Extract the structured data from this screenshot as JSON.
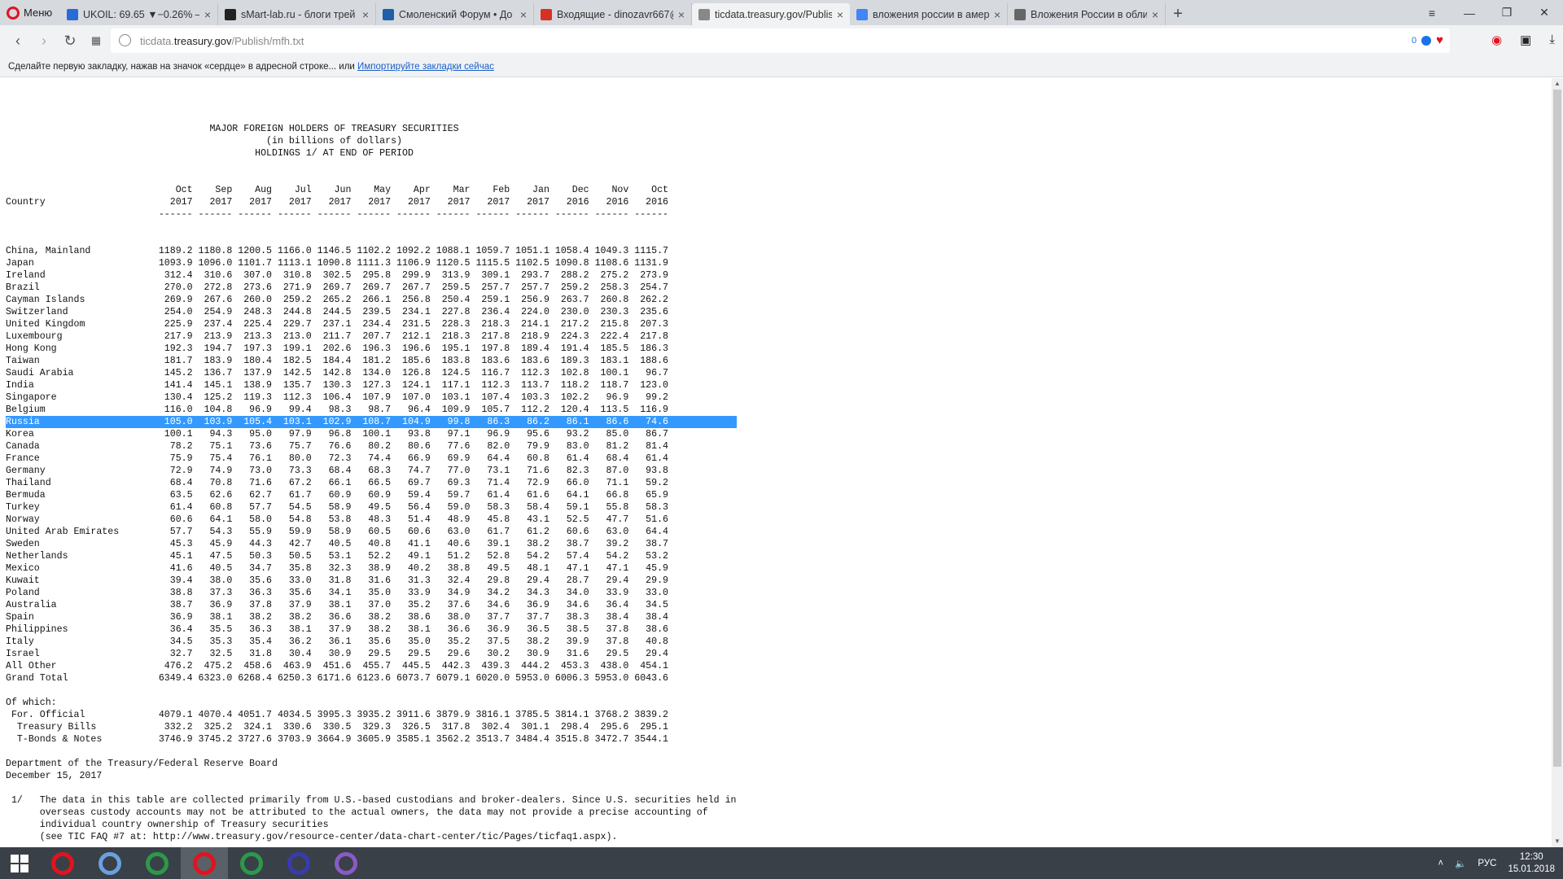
{
  "browser": {
    "menu_label": "Меню",
    "tabs": [
      {
        "title": "UKOIL: 69.65 ▼−0.26% —",
        "favicon": "chart-icon",
        "color": "#2a6ad8"
      },
      {
        "title": "sMart-lab.ru - блоги трей",
        "favicon": "smartlab-icon",
        "color": "#222222"
      },
      {
        "title": "Смоленский Форум • Дo",
        "favicon": "forum-icon",
        "color": "#1f5fa8"
      },
      {
        "title": "Входящие - dinozavr667@",
        "favicon": "gmail-icon",
        "color": "#d93025"
      },
      {
        "title": "ticdata.treasury.gov/Publis",
        "favicon": "page-icon",
        "color": "#888888"
      },
      {
        "title": "вложения россии в амер",
        "favicon": "google-icon",
        "color": "#4285f4"
      },
      {
        "title": "Вложения России в обли",
        "favicon": "loading-icon",
        "color": "#666666"
      }
    ],
    "url_prefix": "ticdata.",
    "url_domain": "treasury.gov",
    "url_path": "/Publish/mfh.txt",
    "badge_count": "0",
    "bookmark_hint": "Сделайте первую закладку, нажав на значок «сердце» в адресной строке... или",
    "bookmark_link": "Импортируйте закладки сейчас"
  },
  "report": {
    "title": "MAJOR FOREIGN HOLDERS OF TREASURY SECURITIES",
    "subtitle": "(in billions of dollars)",
    "subtitle2": "HOLDINGS 1/ AT END OF PERIOD",
    "country_header": "Country",
    "months": [
      "Oct",
      "Sep",
      "Aug",
      "Jul",
      "Jun",
      "May",
      "Apr",
      "Mar",
      "Feb",
      "Jan",
      "Dec",
      "Nov",
      "Oct"
    ],
    "years": [
      "2017",
      "2017",
      "2017",
      "2017",
      "2017",
      "2017",
      "2017",
      "2017",
      "2017",
      "2017",
      "2016",
      "2016",
      "2016"
    ],
    "rows": [
      {
        "country": "China, Mainland",
        "values": [
          "1189.2",
          "1180.8",
          "1200.5",
          "1166.0",
          "1146.5",
          "1102.2",
          "1092.2",
          "1088.1",
          "1059.7",
          "1051.1",
          "1058.4",
          "1049.3",
          "1115.7"
        ]
      },
      {
        "country": "Japan",
        "values": [
          "1093.9",
          "1096.0",
          "1101.7",
          "1113.1",
          "1090.8",
          "1111.3",
          "1106.9",
          "1120.5",
          "1115.5",
          "1102.5",
          "1090.8",
          "1108.6",
          "1131.9"
        ]
      },
      {
        "country": "Ireland",
        "values": [
          "312.4",
          "310.6",
          "307.0",
          "310.8",
          "302.5",
          "295.8",
          "299.9",
          "313.9",
          "309.1",
          "293.7",
          "288.2",
          "275.2",
          "273.9"
        ]
      },
      {
        "country": "Brazil",
        "values": [
          "270.0",
          "272.8",
          "273.6",
          "271.9",
          "269.7",
          "269.7",
          "267.7",
          "259.5",
          "257.7",
          "257.7",
          "259.2",
          "258.3",
          "254.7"
        ]
      },
      {
        "country": "Cayman Islands",
        "values": [
          "269.9",
          "267.6",
          "260.0",
          "259.2",
          "265.2",
          "266.1",
          "256.8",
          "250.4",
          "259.1",
          "256.9",
          "263.7",
          "260.8",
          "262.2"
        ]
      },
      {
        "country": "Switzerland",
        "values": [
          "254.0",
          "254.9",
          "248.3",
          "244.8",
          "244.5",
          "239.5",
          "234.1",
          "227.8",
          "236.4",
          "224.0",
          "230.0",
          "230.3",
          "235.6"
        ]
      },
      {
        "country": "United Kingdom",
        "values": [
          "225.9",
          "237.4",
          "225.4",
          "229.7",
          "237.1",
          "234.4",
          "231.5",
          "228.3",
          "218.3",
          "214.1",
          "217.2",
          "215.8",
          "207.3"
        ]
      },
      {
        "country": "Luxembourg",
        "values": [
          "217.9",
          "213.9",
          "213.3",
          "213.0",
          "211.7",
          "207.7",
          "212.1",
          "218.3",
          "217.8",
          "218.9",
          "224.3",
          "222.4",
          "217.8"
        ]
      },
      {
        "country": "Hong Kong",
        "values": [
          "192.3",
          "194.7",
          "197.3",
          "199.1",
          "202.6",
          "196.3",
          "196.6",
          "195.1",
          "197.8",
          "189.4",
          "191.4",
          "185.5",
          "186.3"
        ]
      },
      {
        "country": "Taiwan",
        "values": [
          "181.7",
          "183.9",
          "180.4",
          "182.5",
          "184.4",
          "181.2",
          "185.6",
          "183.8",
          "183.6",
          "183.6",
          "189.3",
          "183.1",
          "188.6"
        ]
      },
      {
        "country": "Saudi Arabia",
        "values": [
          "145.2",
          "136.7",
          "137.9",
          "142.5",
          "142.8",
          "134.0",
          "126.8",
          "124.5",
          "116.7",
          "112.3",
          "102.8",
          "100.1",
          "96.7"
        ]
      },
      {
        "country": "India",
        "values": [
          "141.4",
          "145.1",
          "138.9",
          "135.7",
          "130.3",
          "127.3",
          "124.1",
          "117.1",
          "112.3",
          "113.7",
          "118.2",
          "118.7",
          "123.0"
        ]
      },
      {
        "country": "Singapore",
        "values": [
          "130.4",
          "125.2",
          "119.3",
          "112.3",
          "106.4",
          "107.9",
          "107.0",
          "103.1",
          "107.4",
          "103.3",
          "102.2",
          "96.9",
          "99.2"
        ]
      },
      {
        "country": "Belgium",
        "values": [
          "116.0",
          "104.8",
          "96.9",
          "99.4",
          "98.3",
          "98.7",
          "96.4",
          "109.9",
          "105.7",
          "112.2",
          "120.4",
          "113.5",
          "116.9"
        ]
      },
      {
        "country": "Russia",
        "values": [
          "105.0",
          "103.9",
          "105.4",
          "103.1",
          "102.9",
          "108.7",
          "104.9",
          "99.8",
          "86.3",
          "86.2",
          "86.1",
          "86.6",
          "74.6"
        ],
        "selected": true
      },
      {
        "country": "Korea",
        "values": [
          "100.1",
          "94.3",
          "95.0",
          "97.9",
          "96.8",
          "100.1",
          "93.8",
          "97.1",
          "96.9",
          "95.6",
          "93.2",
          "85.0",
          "86.7"
        ]
      },
      {
        "country": "Canada",
        "values": [
          "78.2",
          "75.1",
          "73.6",
          "75.7",
          "76.6",
          "80.2",
          "80.6",
          "77.6",
          "82.0",
          "79.9",
          "83.0",
          "81.2",
          "81.4"
        ]
      },
      {
        "country": "France",
        "values": [
          "75.9",
          "75.4",
          "76.1",
          "80.0",
          "72.3",
          "74.4",
          "66.9",
          "69.9",
          "64.4",
          "60.8",
          "61.4",
          "68.4",
          "61.4"
        ]
      },
      {
        "country": "Germany",
        "values": [
          "72.9",
          "74.9",
          "73.0",
          "73.3",
          "68.4",
          "68.3",
          "74.7",
          "77.0",
          "73.1",
          "71.6",
          "82.3",
          "87.0",
          "93.8"
        ]
      },
      {
        "country": "Thailand",
        "values": [
          "68.4",
          "70.8",
          "71.6",
          "67.2",
          "66.1",
          "66.5",
          "69.7",
          "69.3",
          "71.4",
          "72.9",
          "66.0",
          "71.1",
          "59.2"
        ]
      },
      {
        "country": "Bermuda",
        "values": [
          "63.5",
          "62.6",
          "62.7",
          "61.7",
          "60.9",
          "60.9",
          "59.4",
          "59.7",
          "61.4",
          "61.6",
          "64.1",
          "66.8",
          "65.9"
        ]
      },
      {
        "country": "Turkey",
        "values": [
          "61.4",
          "60.8",
          "57.7",
          "54.5",
          "58.9",
          "49.5",
          "56.4",
          "59.0",
          "58.3",
          "58.4",
          "59.1",
          "55.8",
          "58.3"
        ]
      },
      {
        "country": "Norway",
        "values": [
          "60.6",
          "64.1",
          "58.0",
          "54.8",
          "53.8",
          "48.3",
          "51.4",
          "48.9",
          "45.8",
          "43.1",
          "52.5",
          "47.7",
          "51.6"
        ]
      },
      {
        "country": "United Arab Emirates",
        "values": [
          "57.7",
          "54.3",
          "55.9",
          "59.9",
          "58.9",
          "60.5",
          "60.6",
          "63.0",
          "61.7",
          "61.2",
          "60.6",
          "63.0",
          "64.4"
        ]
      },
      {
        "country": "Sweden",
        "values": [
          "45.3",
          "45.9",
          "44.3",
          "42.7",
          "40.5",
          "40.8",
          "41.1",
          "40.6",
          "39.1",
          "38.2",
          "38.7",
          "39.2",
          "38.7"
        ]
      },
      {
        "country": "Netherlands",
        "values": [
          "45.1",
          "47.5",
          "50.3",
          "50.5",
          "53.1",
          "52.2",
          "49.1",
          "51.2",
          "52.8",
          "54.2",
          "57.4",
          "54.2",
          "53.2"
        ]
      },
      {
        "country": "Mexico",
        "values": [
          "41.6",
          "40.5",
          "34.7",
          "35.8",
          "32.3",
          "38.9",
          "40.2",
          "38.8",
          "49.5",
          "48.1",
          "47.1",
          "47.1",
          "45.9"
        ]
      },
      {
        "country": "Kuwait",
        "values": [
          "39.4",
          "38.0",
          "35.6",
          "33.0",
          "31.8",
          "31.6",
          "31.3",
          "32.4",
          "29.8",
          "29.4",
          "28.7",
          "29.4",
          "29.9"
        ]
      },
      {
        "country": "Poland",
        "values": [
          "38.8",
          "37.3",
          "36.3",
          "35.6",
          "34.1",
          "35.0",
          "33.9",
          "34.9",
          "34.2",
          "34.3",
          "34.0",
          "33.9",
          "33.0"
        ]
      },
      {
        "country": "Australia",
        "values": [
          "38.7",
          "36.9",
          "37.8",
          "37.9",
          "38.1",
          "37.0",
          "35.2",
          "37.6",
          "34.6",
          "36.9",
          "34.6",
          "36.4",
          "34.5"
        ]
      },
      {
        "country": "Spain",
        "values": [
          "36.9",
          "38.1",
          "38.2",
          "38.2",
          "36.6",
          "38.2",
          "38.6",
          "38.0",
          "37.7",
          "37.7",
          "38.3",
          "38.4",
          "38.4"
        ]
      },
      {
        "country": "Philippines",
        "values": [
          "36.4",
          "35.5",
          "36.3",
          "38.1",
          "37.9",
          "38.2",
          "38.1",
          "36.6",
          "36.9",
          "36.5",
          "38.5",
          "37.8",
          "38.6"
        ]
      },
      {
        "country": "Italy",
        "values": [
          "34.5",
          "35.3",
          "35.4",
          "36.2",
          "36.1",
          "35.6",
          "35.0",
          "35.2",
          "37.5",
          "38.2",
          "39.9",
          "37.8",
          "40.8"
        ]
      },
      {
        "country": "Israel",
        "values": [
          "32.7",
          "32.5",
          "31.8",
          "30.4",
          "30.9",
          "29.5",
          "29.5",
          "29.6",
          "30.2",
          "30.9",
          "31.6",
          "29.5",
          "29.4"
        ]
      },
      {
        "country": "All Other",
        "values": [
          "476.2",
          "475.2",
          "458.6",
          "463.9",
          "451.6",
          "455.7",
          "445.5",
          "442.3",
          "439.3",
          "444.2",
          "453.3",
          "438.0",
          "454.1"
        ]
      },
      {
        "country": "Grand Total",
        "values": [
          "6349.4",
          "6323.0",
          "6268.4",
          "6250.3",
          "6171.6",
          "6123.6",
          "6073.7",
          "6079.1",
          "6020.0",
          "5953.0",
          "6006.3",
          "5953.0",
          "6043.6"
        ]
      }
    ],
    "of_which_label": "Of which:",
    "of_which": [
      {
        "country": " For. Official",
        "values": [
          "4079.1",
          "4070.4",
          "4051.7",
          "4034.5",
          "3995.3",
          "3935.2",
          "3911.6",
          "3879.9",
          "3816.1",
          "3785.5",
          "3814.1",
          "3768.2",
          "3839.2"
        ]
      },
      {
        "country": "  Treasury Bills",
        "values": [
          "332.2",
          "325.2",
          "324.1",
          "330.6",
          "330.5",
          "329.3",
          "326.5",
          "317.8",
          "302.4",
          "301.1",
          "298.4",
          "295.6",
          "295.1"
        ]
      },
      {
        "country": "  T-Bonds & Notes",
        "values": [
          "3746.9",
          "3745.2",
          "3727.6",
          "3703.9",
          "3664.9",
          "3605.9",
          "3585.1",
          "3562.2",
          "3513.7",
          "3484.4",
          "3515.8",
          "3472.7",
          "3544.1"
        ]
      }
    ],
    "dept": "Department of the Treasury/Federal Reserve Board",
    "date": "December 15, 2017",
    "footnote_lines": [
      " 1/   The data in this table are collected primarily from U.S.-based custodians and broker-dealers. Since U.S. securities held in",
      "      overseas custody accounts may not be attributed to the actual owners, the data may not provide a precise accounting of",
      "      individual country ownership of Treasury securities",
      "      (see TIC FAQ #7 at: http://www.treasury.gov/resource-center/data-chart-center/tic/Pages/ticfaq1.aspx)."
    ]
  },
  "taskbar": {
    "apps": [
      {
        "name": "opera-icon",
        "color": "#e0141e",
        "active": false
      },
      {
        "name": "speaker-app-icon",
        "color": "#6aa0e0",
        "active": false
      },
      {
        "name": "quik-icon",
        "color": "#2a9a4a",
        "active": false
      },
      {
        "name": "opera-browser-icon",
        "color": "#e0141e",
        "active": true
      },
      {
        "name": "quik2-icon",
        "color": "#2a9a4a",
        "active": false
      },
      {
        "name": "floppy-icon",
        "color": "#3a3ab0",
        "active": false
      },
      {
        "name": "visual-studio-icon",
        "color": "#8a5ac8",
        "active": false
      }
    ],
    "lang": "РУС",
    "time": "12:30",
    "date": "15.01.2018"
  }
}
